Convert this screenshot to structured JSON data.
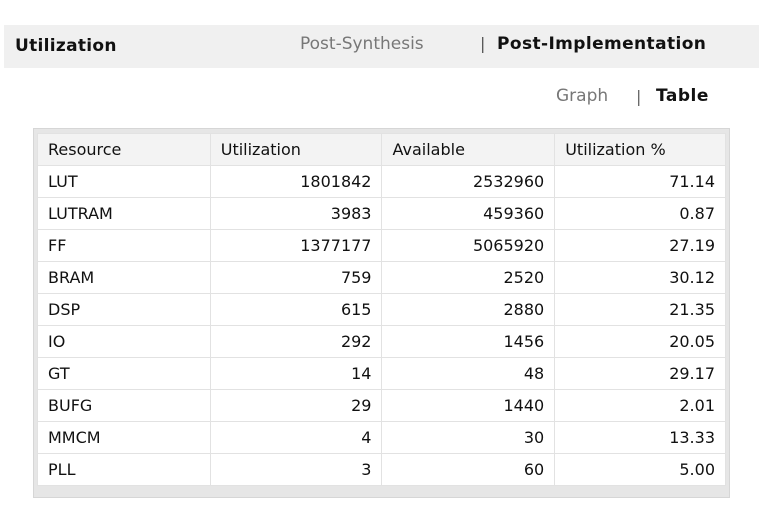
{
  "header": {
    "title": "Utilization",
    "tabs": {
      "post_synthesis": "Post-Synthesis",
      "separator": "|",
      "post_implementation": "Post-Implementation"
    }
  },
  "view": {
    "graph": "Graph",
    "separator": "|",
    "table": "Table"
  },
  "table": {
    "columns": [
      "Resource",
      "Utilization",
      "Available",
      "Utilization %"
    ],
    "rows": [
      [
        "LUT",
        "1801842",
        "2532960",
        "71.14"
      ],
      [
        "LUTRAM",
        "3983",
        "459360",
        "0.87"
      ],
      [
        "FF",
        "1377177",
        "5065920",
        "27.19"
      ],
      [
        "BRAM",
        "759",
        "2520",
        "30.12"
      ],
      [
        "DSP",
        "615",
        "2880",
        "21.35"
      ],
      [
        "IO",
        "292",
        "1456",
        "20.05"
      ],
      [
        "GT",
        "14",
        "48",
        "29.17"
      ],
      [
        "BUFG",
        "29",
        "1440",
        "2.01"
      ],
      [
        "MMCM",
        "4",
        "30",
        "13.33"
      ],
      [
        "PLL",
        "3",
        "60",
        "5.00"
      ]
    ]
  }
}
